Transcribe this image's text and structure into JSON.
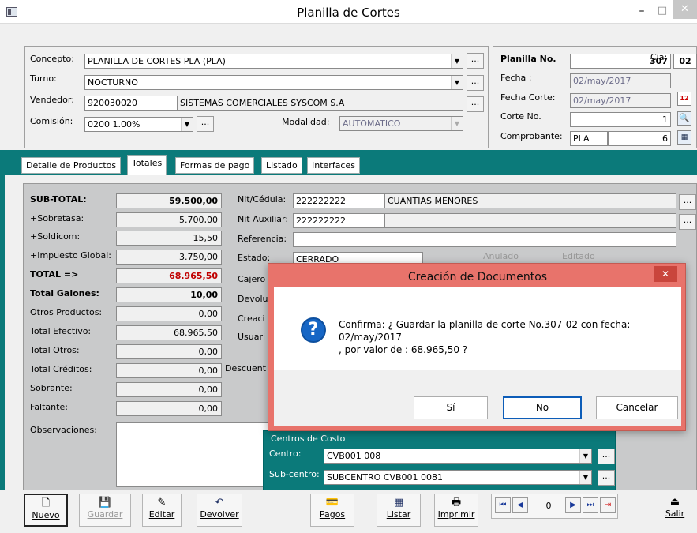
{
  "window": {
    "title": "Planilla de Cortes",
    "min_label": "–",
    "max_label": "□",
    "close_label": "✕"
  },
  "header": {
    "concepto_label": "Concepto:",
    "concepto_value": "PLANILLA DE CORTES PLA  (PLA)",
    "turno_label": "Turno:",
    "turno_value": "NOCTURNO",
    "vendedor_label": "Vendedor:",
    "vendedor_code": "920030020",
    "vendedor_name": "SISTEMAS COMERCIALES SYSCOM S.A",
    "comision_label": "Comisión:",
    "comision_value": "0200  1.00%",
    "modalidad_label": "Modalidad:",
    "modalidad_value": "AUTOMATICO",
    "dots": "..."
  },
  "planilla": {
    "no_label": "Planilla No.",
    "no_value": "307",
    "cia_label": "Cia:",
    "cia_value": "02",
    "fecha_label": "Fecha :",
    "fecha_value": "02/may/2017",
    "fecha_corte_label": "Fecha Corte:",
    "fecha_corte_value": "02/may/2017",
    "corte_no_label": "Corte No.",
    "corte_no_value": "1",
    "comprobante_label": "Comprobante:",
    "comprobante_type": "PLA",
    "comprobante_value": "6"
  },
  "tabs": [
    "Detalle de Productos",
    "Totales",
    "Formas de pago",
    "Listado",
    "Interfaces"
  ],
  "totals": [
    {
      "label": "SUB-TOTAL:",
      "value": "59.500,00",
      "bold": true
    },
    {
      "label": "+Sobretasa:",
      "value": "5.700,00",
      "bold": false
    },
    {
      "label": "+Soldicom:",
      "value": "15,50",
      "bold": false
    },
    {
      "label": "+Impuesto Global:",
      "value": "3.750,00",
      "bold": false
    },
    {
      "label": "TOTAL =>",
      "value": "68.965,50",
      "bold": true
    },
    {
      "label": "Total Galones:",
      "value": "10,00",
      "bold": true
    },
    {
      "label": "Otros Productos:",
      "value": "0,00",
      "bold": false
    },
    {
      "label": "Total Efectivo:",
      "value": "68.965,50",
      "bold": false
    },
    {
      "label": "Total Otros:",
      "value": "0,00",
      "bold": false
    },
    {
      "label": "Total Créditos:",
      "value": "0,00",
      "bold": false
    },
    {
      "label": "Sobrante:",
      "value": "0,00",
      "bold": false
    },
    {
      "label": "Faltante:",
      "value": "0,00",
      "bold": false
    }
  ],
  "observaciones_label": "Observaciones:",
  "right": {
    "nit_label": "Nit/Cédula:",
    "nit_value": "222222222",
    "nit_name": "CUANTIAS MENORES",
    "nit_aux_label": "Nit Auxiliar:",
    "nit_aux_value": "222222222",
    "referencia_label": "Referencia:",
    "estado_label": "Estado:",
    "estado_value": "CERRADO",
    "anulado_label": "Anulado",
    "editado_label": "Editado",
    "cajero_label": "Cajero",
    "devolu_label": "Devolu",
    "creaci_label": "Creaci",
    "usuari_label": "Usuari",
    "descuent_label": "Descuent"
  },
  "centros": {
    "title": "Centros de Costo",
    "centro_label": "Centro:",
    "centro_value": "CVB001 008",
    "subcentro_label": "Sub-centro:",
    "subcentro_value": "SUBCENTRO CVB001 0081"
  },
  "toolbar": {
    "nuevo": "Nuevo",
    "guardar": "Guardar",
    "editar": "Editar",
    "devolver": "Devolver",
    "pagos": "Pagos",
    "listar": "Listar",
    "imprimir": "Imprimir",
    "record": "0",
    "salir": "Salir"
  },
  "dialog": {
    "title": "Creación de Documentos",
    "message_line1": "Confirma: ¿ Guardar la planilla de corte No.307-02 con fecha:",
    "message_line2": "02/may/2017",
    "message_line3": ", por valor de : 68.965,50 ?",
    "yes": "Sí",
    "no": "No",
    "cancel": "Cancelar",
    "close": "✕"
  },
  "colors": {
    "teal": "#0b7a7a",
    "dialog_border": "#e8736b",
    "accent": "#0d5db8",
    "total_red": "#c00000"
  }
}
